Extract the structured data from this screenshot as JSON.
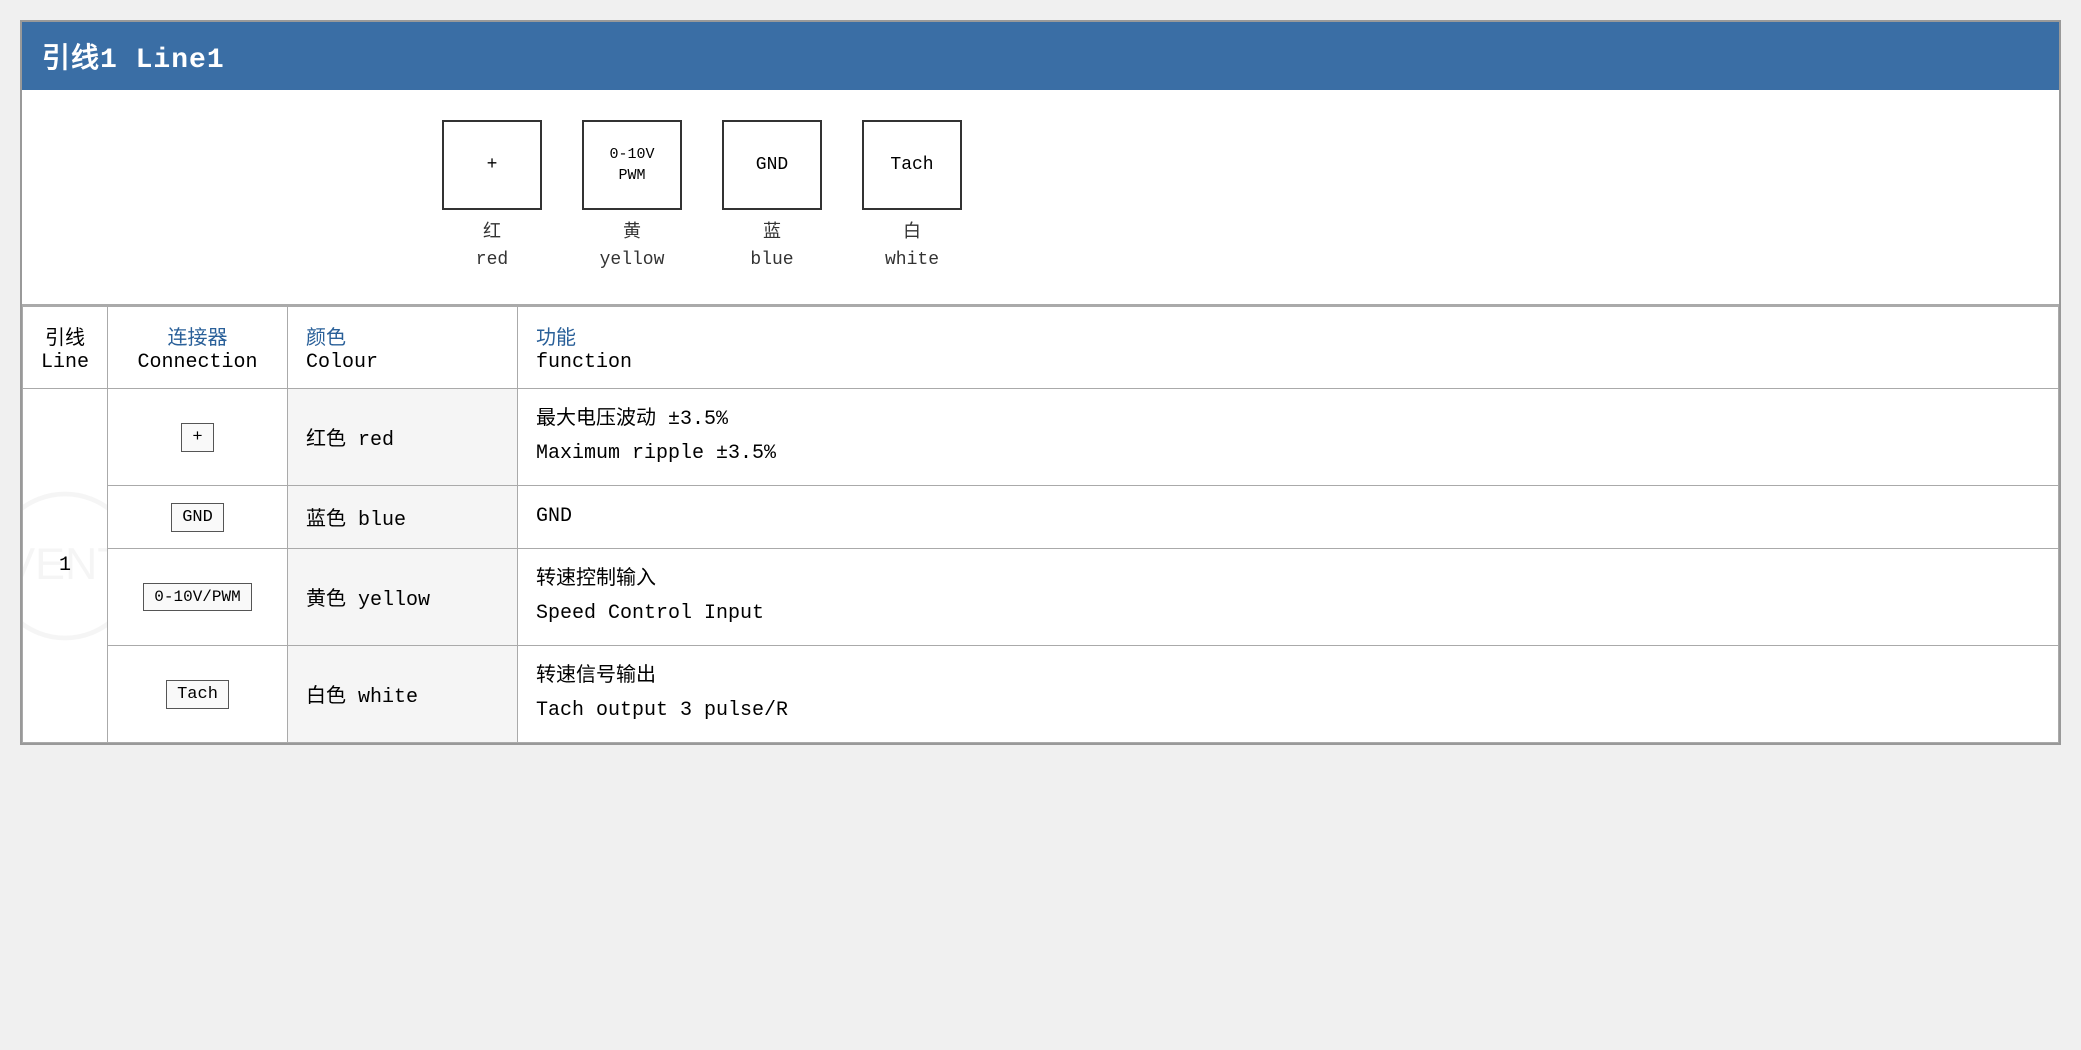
{
  "title": "引线1 Line1",
  "diagram": {
    "connectors": [
      {
        "symbol": "+",
        "label_zh": "红",
        "label_en": "red"
      },
      {
        "symbol": "0-10V\nPWM",
        "label_zh": "黄",
        "label_en": "yellow"
      },
      {
        "symbol": "GND",
        "label_zh": "蓝",
        "label_en": "blue"
      },
      {
        "symbol": "Tach",
        "label_zh": "白",
        "label_en": "white"
      }
    ]
  },
  "table": {
    "headers": {
      "line_zh": "引线",
      "line_en": "Line",
      "connection_zh": "连接器",
      "connection_en": "Connection",
      "colour_zh": "颜色",
      "colour_en": "Colour",
      "function_zh": "功能",
      "function_en": "function"
    },
    "rows": [
      {
        "line": "1",
        "connection": "+",
        "colour": "红色 red",
        "function_zh": "最大电压波动 ±3.5%",
        "function_en": "Maximum ripple ±3.5%"
      },
      {
        "line": "",
        "connection": "GND",
        "colour": "蓝色 blue",
        "function_zh": "GND",
        "function_en": ""
      },
      {
        "line": "",
        "connection": "0-10V/PWM",
        "colour": "黄色 yellow",
        "function_zh": "转速控制输入",
        "function_en": "Speed Control Input"
      },
      {
        "line": "",
        "connection": "Tach",
        "colour": "白色 white",
        "function_zh": "转速信号输出",
        "function_en": "Tach output 3 pulse/R"
      }
    ]
  },
  "accent_color": "#3a6ea5",
  "text_blue": "#2a6099"
}
